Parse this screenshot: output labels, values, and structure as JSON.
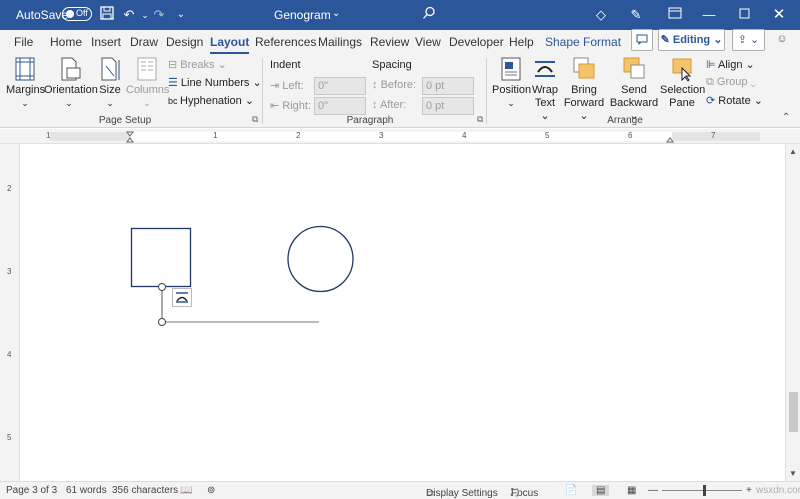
{
  "titlebar": {
    "autosave_label": "AutoSave",
    "autosave_state": "Off",
    "document_title": "Genogram"
  },
  "tabs": [
    {
      "label": "File"
    },
    {
      "label": "Home"
    },
    {
      "label": "Insert"
    },
    {
      "label": "Draw"
    },
    {
      "label": "Design"
    },
    {
      "label": "Layout"
    },
    {
      "label": "References"
    },
    {
      "label": "Mailings"
    },
    {
      "label": "Review"
    },
    {
      "label": "View"
    },
    {
      "label": "Developer"
    },
    {
      "label": "Help"
    },
    {
      "label": "Shape Format"
    }
  ],
  "editing_label": "Editing",
  "ribbon": {
    "page_setup": {
      "label": "Page Setup",
      "margins": "Margins",
      "orientation": "Orientation",
      "size": "Size",
      "columns": "Columns",
      "breaks": "Breaks",
      "line_numbers": "Line Numbers",
      "hyphenation": "Hyphenation"
    },
    "paragraph": {
      "label": "Paragraph",
      "indent": "Indent",
      "spacing": "Spacing",
      "left": "Left:",
      "right": "Right:",
      "before": "Before:",
      "after": "After:",
      "left_value": "0\"",
      "right_value": "0\"",
      "before_value": "0 pt",
      "after_value": "0 pt"
    },
    "arrange": {
      "label": "Arrange",
      "position": "Position",
      "wrap_text_1": "Wrap",
      "wrap_text_2": "Text",
      "bring_forward_1": "Bring",
      "bring_forward_2": "Forward",
      "send_backward_1": "Send",
      "send_backward_2": "Backward",
      "selection_pane_1": "Selection",
      "selection_pane_2": "Pane",
      "align": "Align",
      "group": "Group",
      "rotate": "Rotate"
    }
  },
  "ruler_numbers": [
    "1",
    "1",
    "2",
    "3",
    "4",
    "5",
    "6",
    "7"
  ],
  "vruler_numbers": [
    "2",
    "3",
    "4",
    "5"
  ],
  "status": {
    "page": "Page 3 of 3",
    "words": "61 words",
    "characters": "356 characters",
    "display_settings": "Display Settings",
    "focus": "Focus",
    "watermark": "wsxdn.com"
  },
  "colors": {
    "accent": "#2b579a",
    "shape_stroke": "#1f3864"
  }
}
